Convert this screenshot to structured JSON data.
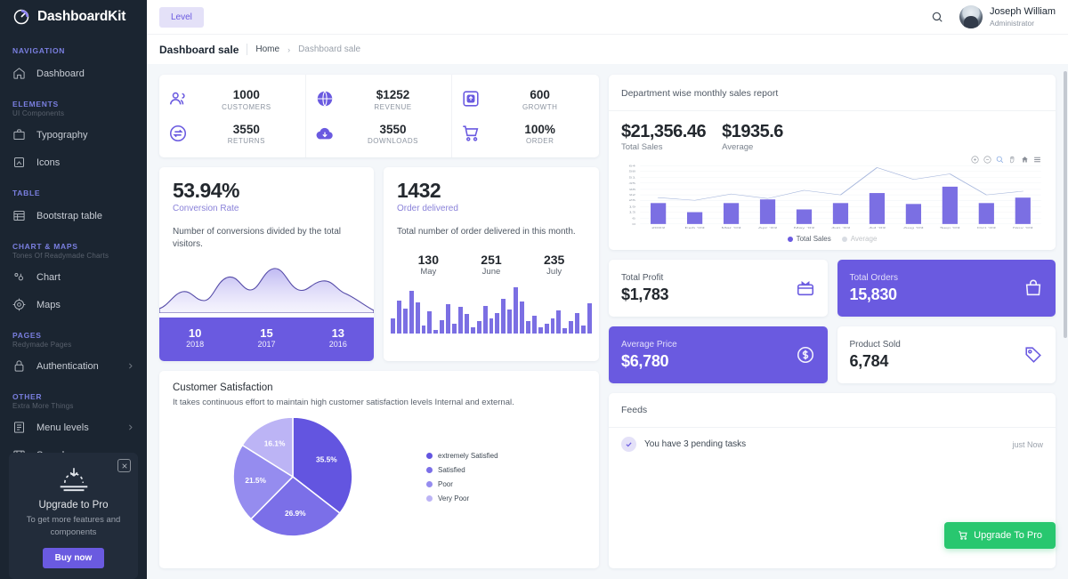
{
  "brand": {
    "name": "DashboardKit",
    "logo_icon": "dashboard-logo-icon"
  },
  "sidebar": {
    "sections": [
      {
        "caption": "NAVIGATION",
        "subcaption": "",
        "items": [
          {
            "label": "Dashboard",
            "icon": "home-icon",
            "has_arrow": false
          }
        ]
      },
      {
        "caption": "ELEMENTS",
        "subcaption": "UI Components",
        "items": [
          {
            "label": "Typography",
            "icon": "typography-icon",
            "has_arrow": false
          },
          {
            "label": "Icons",
            "icon": "icons-icon",
            "has_arrow": false
          }
        ]
      },
      {
        "caption": "TABLE",
        "subcaption": "",
        "items": [
          {
            "label": "Bootstrap table",
            "icon": "table-icon",
            "has_arrow": false
          }
        ]
      },
      {
        "caption": "CHART & MAPS",
        "subcaption": "Tones Of Readymade Charts",
        "items": [
          {
            "label": "Chart",
            "icon": "chart-icon",
            "has_arrow": false
          },
          {
            "label": "Maps",
            "icon": "maps-icon",
            "has_arrow": false
          }
        ]
      },
      {
        "caption": "PAGES",
        "subcaption": "Redymade Pages",
        "items": [
          {
            "label": "Authentication",
            "icon": "lock-icon",
            "has_arrow": true
          }
        ]
      },
      {
        "caption": "OTHER",
        "subcaption": "Extra More Things",
        "items": [
          {
            "label": "Menu levels",
            "icon": "menu-levels-icon",
            "has_arrow": true
          },
          {
            "label": "Sample page",
            "icon": "sample-page-icon",
            "has_arrow": false
          }
        ]
      }
    ],
    "upgrade": {
      "title": "Upgrade to Pro",
      "subtitle": "To get more features and components",
      "button": "Buy now",
      "close_icon": "close-icon",
      "art_icon": "sunrise-icon"
    }
  },
  "topbar": {
    "level_button": "Level",
    "search_icon": "search-icon",
    "user": {
      "name": "Joseph William",
      "role": "Administrator",
      "avatar_icon": "avatar"
    }
  },
  "breadcrumb": {
    "title": "Dashboard sale",
    "home": "Home",
    "arrow": "›",
    "current": "Dashboard sale"
  },
  "stats": [
    {
      "icon": "customers-icon",
      "value": "1000",
      "label": "CUSTOMERS"
    },
    {
      "icon": "globe-icon",
      "value": "$1252",
      "label": "REVENUE"
    },
    {
      "icon": "growth-icon",
      "value": "600",
      "label": "GROWTH"
    },
    {
      "icon": "returns-icon",
      "value": "3550",
      "label": "RETURNS"
    },
    {
      "icon": "download-icon",
      "value": "3550",
      "label": "DOWNLOADS"
    },
    {
      "icon": "cart-icon",
      "value": "100%",
      "label": "ORDER"
    }
  ],
  "conversion": {
    "value": "53.94%",
    "label": "Conversion Rate",
    "description": "Number of conversions divided by the total visitors.",
    "footer": [
      {
        "num": "10",
        "year": "2018"
      },
      {
        "num": "15",
        "year": "2017"
      },
      {
        "num": "13",
        "year": "2016"
      }
    ]
  },
  "order_delivered": {
    "value": "1432",
    "label": "Order delivered",
    "description": "Total number of order delivered in this month.",
    "months": [
      {
        "num": "130",
        "name": "May"
      },
      {
        "num": "251",
        "name": "June"
      },
      {
        "num": "235",
        "name": "July"
      }
    ]
  },
  "sales_report": {
    "title": "Department wise monthly sales report",
    "total_sales_value": "$21,356.46",
    "total_sales_label": "Total Sales",
    "average_value": "$1935.6",
    "average_label": "Average",
    "toolbar_icons": [
      "zoom-in-icon",
      "zoom-out-icon",
      "selection-zoom-icon",
      "pan-icon",
      "reset-home-icon",
      "menu-icon"
    ]
  },
  "satisfaction": {
    "title": "Customer Satisfaction",
    "description": "It takes continuous effort to maintain high customer satisfaction levels Internal and external."
  },
  "kpis": [
    {
      "label": "Total Profit",
      "value": "$1,783",
      "icon": "wallet-icon",
      "style": "white"
    },
    {
      "label": "Total Orders",
      "value": "15,830",
      "icon": "bag-icon",
      "style": "purple"
    },
    {
      "label": "Average Price",
      "value": "$6,780",
      "icon": "dollar-icon",
      "style": "purple"
    },
    {
      "label": "Product Sold",
      "value": "6,784",
      "icon": "tag-icon",
      "style": "white"
    }
  ],
  "feeds": {
    "title": "Feeds",
    "rows": [
      {
        "icon": "check-icon",
        "text": "You have 3 pending tasks",
        "time": "just Now"
      }
    ]
  },
  "upgrade_pro_button": {
    "label": "Upgrade To Pro",
    "icon": "cart-icon",
    "color": "#28c76f"
  },
  "colors": {
    "accent": "#6a5ae0",
    "sidebar": "#1b2531",
    "page_bg": "#f4f7fa",
    "success": "#28c76f"
  },
  "chart_data": [
    {
      "id": "department-sales",
      "type": "bar",
      "title": "Department wise monthly sales report",
      "categories": [
        "2003",
        "Feb '03",
        "Mar '03",
        "Apr '03",
        "May '03",
        "Jun '03",
        "Jul '03",
        "Aug '03",
        "Sep '03",
        "Oct '03",
        "Nov '03"
      ],
      "ytick_labels": [
        "0",
        "6",
        "13",
        "19",
        "26",
        "32",
        "38",
        "45",
        "51",
        "58",
        "64"
      ],
      "ylim": [
        0,
        64
      ],
      "grid": true,
      "legend_position": "bottom",
      "series": [
        {
          "name": "Total Sales",
          "type": "bar",
          "color": "#7b6fe3",
          "active": true,
          "values": [
            23,
            13,
            23,
            27,
            16,
            23,
            34,
            22,
            41,
            23,
            29
          ]
        },
        {
          "name": "Average",
          "type": "line",
          "color": "#a8b8dd",
          "active": false,
          "values": [
            29,
            26,
            33,
            28,
            37,
            32,
            62,
            49,
            55,
            32,
            36
          ]
        }
      ]
    },
    {
      "id": "customer-satisfaction",
      "type": "pie",
      "title": "Customer Satisfaction",
      "labels": [
        "extremely Satisfied",
        "Satisfied",
        "Poor",
        "Very Poor"
      ],
      "values": [
        35.5,
        26.9,
        21.5,
        16.1
      ],
      "value_labels": [
        "35.5%",
        "26.9%",
        "21.5%",
        "16.1%"
      ],
      "colors": [
        "#6355e0",
        "#7b6fe8",
        "#958cef",
        "#bcb4f5"
      ],
      "legend_position": "right"
    },
    {
      "id": "conversion-rate-area",
      "type": "area",
      "title": "Conversion Rate",
      "color": "#6a5ae0",
      "values": [
        8,
        14,
        22,
        16,
        15,
        34,
        40,
        31,
        28,
        46,
        52,
        38,
        26,
        22,
        30,
        34,
        26,
        16,
        6
      ]
    },
    {
      "id": "order-delivered-bars",
      "type": "bar",
      "title": "Order delivered",
      "color": "#7b6fe3",
      "values": [
        22,
        48,
        36,
        62,
        45,
        12,
        32,
        6,
        20,
        42,
        14,
        38,
        28,
        10,
        18,
        40,
        22,
        30,
        50,
        35,
        66,
        46,
        18,
        26,
        10,
        14,
        22,
        34,
        8,
        18,
        30,
        12,
        44
      ]
    }
  ]
}
